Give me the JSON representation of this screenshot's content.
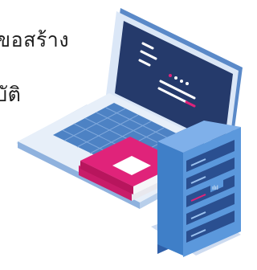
{
  "text": {
    "line_1": "ขอสร้าง",
    "line_2": "ฏิบัติ"
  },
  "server": {
    "label": "ılıl"
  },
  "colors": {
    "laptop_screen": "#253a6b",
    "laptop_body": "#dfeaf8",
    "keyboard": "#4d82c4",
    "server_front": "#3f7fc8",
    "server_side": "#2f5fa8",
    "book_pink": "#e0237a",
    "shadow": "#d9e6f7"
  }
}
